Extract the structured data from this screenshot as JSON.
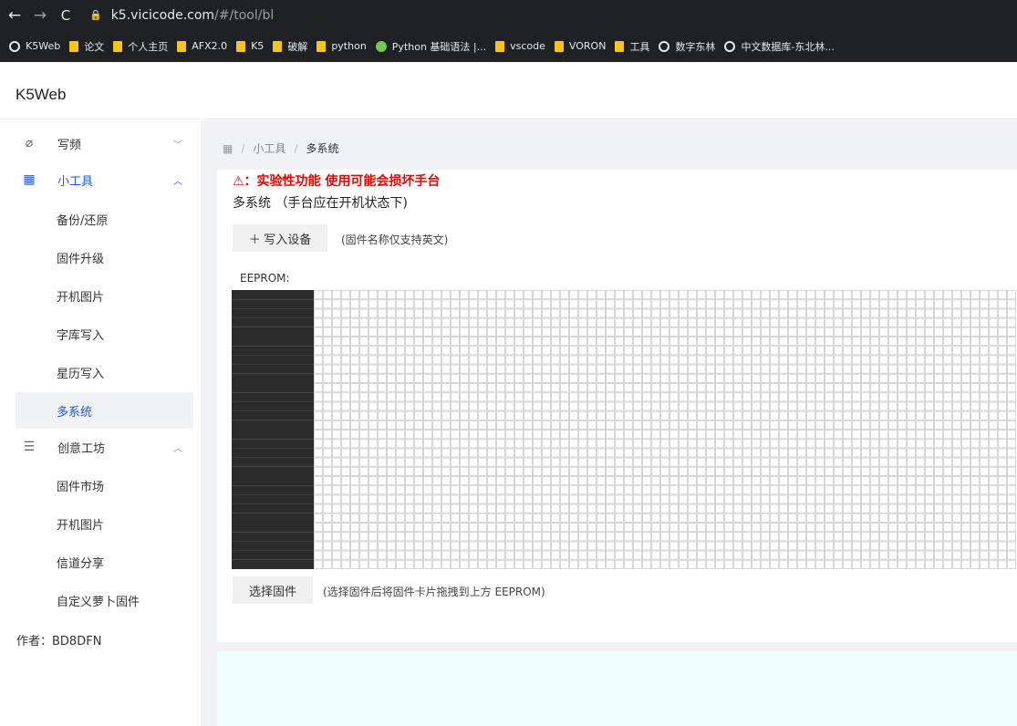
{
  "browser": {
    "url_host": "k5.vicicode.com",
    "url_path": "/#/tool/bl",
    "bookmarks": [
      {
        "label": "K5Web",
        "icon": "globe"
      },
      {
        "label": "论文",
        "icon": "folder"
      },
      {
        "label": "个人主页",
        "icon": "folder"
      },
      {
        "label": "AFX2.0",
        "icon": "folder"
      },
      {
        "label": "K5",
        "icon": "folder"
      },
      {
        "label": "破解",
        "icon": "folder"
      },
      {
        "label": "python",
        "icon": "folder"
      },
      {
        "label": "Python 基础语法 |...",
        "icon": "green"
      },
      {
        "label": "vscode",
        "icon": "folder"
      },
      {
        "label": "VORON",
        "icon": "folder"
      },
      {
        "label": "工具",
        "icon": "folder"
      },
      {
        "label": "数字东林",
        "icon": "globe"
      },
      {
        "label": "中文数据库-东北林...",
        "icon": "globe"
      }
    ]
  },
  "app": {
    "title": "K5Web"
  },
  "sidebar": {
    "groups": [
      {
        "label": "写频",
        "icon": "gauge",
        "expanded": false
      },
      {
        "label": "小工具",
        "icon": "grid",
        "expanded": true,
        "items": [
          "备份/还原",
          "固件升级",
          "开机图片",
          "字库写入",
          "星历写入",
          "多系统"
        ]
      },
      {
        "label": "创意工坊",
        "icon": "list",
        "expanded": true,
        "items": [
          "固件市场",
          "开机图片",
          "信道分享",
          "自定义萝卜固件"
        ]
      }
    ],
    "active_item": "多系统",
    "author": "作者：BD8DFN"
  },
  "breadcrumb": {
    "items": [
      "小工具",
      "多系统"
    ]
  },
  "page": {
    "warning": "⚠：实验性功能 使用可能会损坏手台",
    "subtitle": "多系统 （手台应在开机状态下)",
    "write_button": "＋ 写入设备",
    "write_hint": "(固件名称仅支持英文)",
    "eeprom_label": "EEPROM:",
    "select_button": "选择固件",
    "select_hint": "(选择固件后将固件卡片拖拽到上方 EEPROM)"
  },
  "colors": {
    "accent": "#1e5bd6",
    "warning": "#e00000",
    "filled_cell": "#2b2b2b"
  }
}
